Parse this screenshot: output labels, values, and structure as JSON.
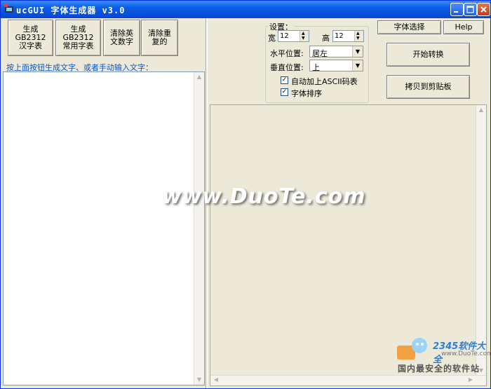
{
  "window": {
    "title": "ucGUI 字体生成器 v3.0",
    "title_color": "#0845d4"
  },
  "titlebar_buttons": [
    "minimize-icon",
    "maximize-icon",
    "close-icon"
  ],
  "left_toolbar": {
    "buttons": [
      {
        "label": "生成GB2312\n汉字表"
      },
      {
        "label": "生成GB2312\n常用字表"
      },
      {
        "label": "清除英\n文数字"
      },
      {
        "label": "清除重\n复的"
      }
    ],
    "hint": "按上面按钮生成文字、或者手动输入文字："
  },
  "settings": {
    "group_title": "设置：",
    "width_label": "宽",
    "width_value": "12",
    "height_label": "高",
    "height_value": "12",
    "h_align_label": "水平位置:",
    "h_align_value": "居左",
    "v_align_label": "垂直位置:",
    "v_align_value": "上",
    "auto_ascii_label": "自动加上ASCII码表",
    "auto_ascii_checked": true,
    "sort_label": "字体排序",
    "sort_checked": true
  },
  "right_buttons": {
    "font_select": "字体选择",
    "help": "Help",
    "start": "开始转换",
    "copy": "拷贝到剪贴板"
  },
  "watermark": {
    "text": "www.DuoTe.com"
  },
  "logo": {
    "brand": "2345软件大全",
    "url": "www.DuoTe.com",
    "slogan": "国内最安全的软件站"
  }
}
